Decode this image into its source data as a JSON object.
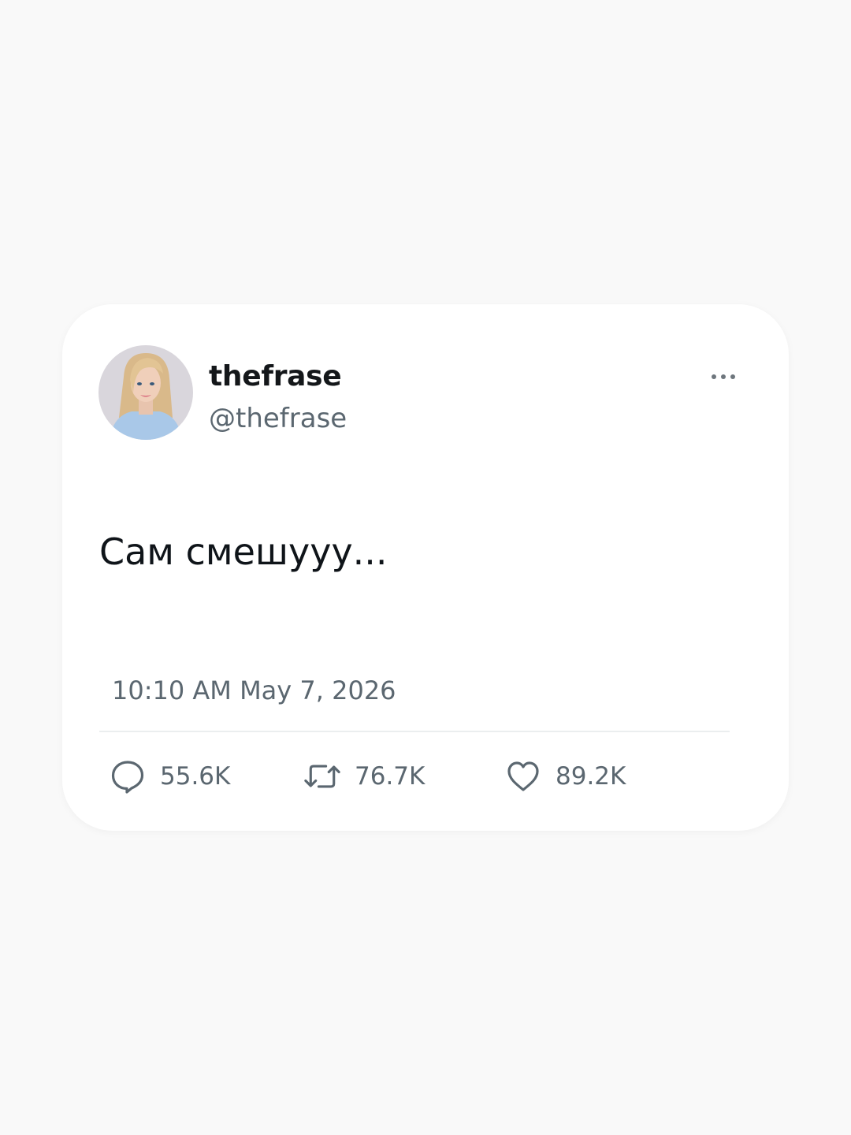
{
  "author": {
    "display_name": "thefrase",
    "handle": "@thefrase",
    "avatar_icon": "woman-portrait-avatar"
  },
  "tweet": {
    "text": "Сам смешууу...",
    "timestamp": "10:10 AM May 7, 2026"
  },
  "actions": {
    "reply": {
      "icon": "comment-icon",
      "count": "55.6K"
    },
    "retweet": {
      "icon": "retweet-icon",
      "count": "76.7K"
    },
    "like": {
      "icon": "heart-icon",
      "count": "89.2K"
    }
  },
  "menu": {
    "icon": "more-options-icon"
  },
  "colors": {
    "background": "#f9f9f9",
    "card": "#ffffff",
    "primary_text": "#14171a",
    "secondary_text": "#5b6770"
  }
}
